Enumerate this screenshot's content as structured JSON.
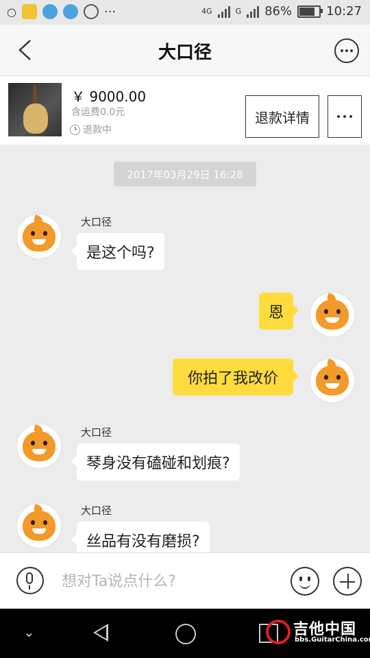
{
  "status_bar": {
    "network": "4G",
    "network2": "G",
    "battery": "86%",
    "battery_level": 0.86,
    "time": "10:27",
    "overflow": "···"
  },
  "header": {
    "title": "大口径"
  },
  "product": {
    "price": "￥ 9000.00",
    "shipping": "含运费0.0元",
    "status": "退款中",
    "refund_button": "退款详情"
  },
  "chat": {
    "timestamp": "2017年03月29日 16:28",
    "messages": [
      {
        "direction": "in",
        "sender": "大口径",
        "text": "是这个吗?"
      },
      {
        "direction": "out",
        "text": "恩"
      },
      {
        "direction": "out",
        "text": "你拍了我改价"
      },
      {
        "direction": "in",
        "sender": "大口径",
        "text": "琴身没有磕碰和划痕?"
      },
      {
        "direction": "in",
        "sender": "大口径",
        "text": "丝品有没有磨损?"
      }
    ]
  },
  "input": {
    "placeholder": "想对Ta说点什么?"
  },
  "watermark": {
    "title": "吉他中国",
    "url": "bbs.GuitarChina.com"
  },
  "colors": {
    "outgoing_bubble": "#fedc3d",
    "incoming_bubble": "#ffffff",
    "chat_background": "#ececec"
  }
}
